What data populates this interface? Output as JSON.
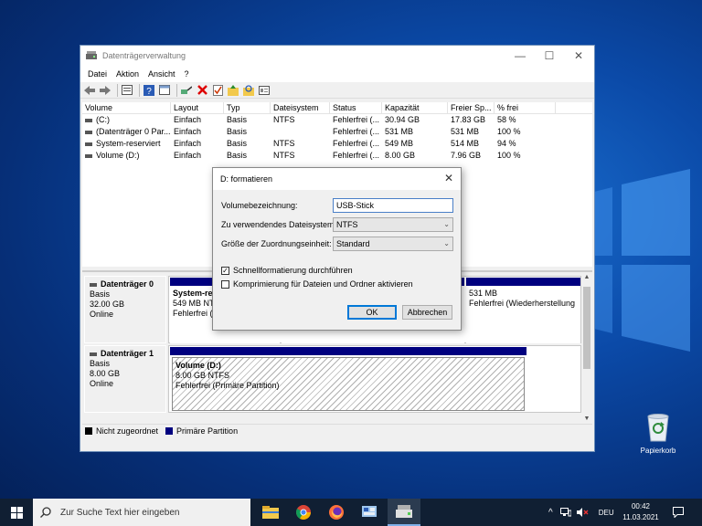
{
  "window": {
    "title": "Datenträgerverwaltung",
    "controls": {
      "minimize": "—",
      "maximize": "☐",
      "close": "✕"
    }
  },
  "menu": [
    "Datei",
    "Aktion",
    "Ansicht",
    "?"
  ],
  "toolbar": [
    "back-icon",
    "forward-icon",
    "properties-icon",
    "help-icon",
    "console-icon",
    "connect-icon",
    "delete-icon",
    "check-icon",
    "folder-up-icon",
    "folder-search-icon",
    "view-icon"
  ],
  "volume_list": {
    "headers": [
      "Volume",
      "Layout",
      "Typ",
      "Dateisystem",
      "Status",
      "Kapazität",
      "Freier Sp...",
      "% frei"
    ],
    "rows": [
      [
        "(C:)",
        "Einfach",
        "Basis",
        "NTFS",
        "Fehlerfrei (...",
        "30.94 GB",
        "17.83 GB",
        "58 %"
      ],
      [
        "(Datenträger 0 Par...",
        "Einfach",
        "Basis",
        "",
        "Fehlerfrei (...",
        "531 MB",
        "531 MB",
        "100 %"
      ],
      [
        "System-reserviert",
        "Einfach",
        "Basis",
        "NTFS",
        "Fehlerfrei (...",
        "549 MB",
        "514 MB",
        "94 %"
      ],
      [
        "Volume (D:)",
        "Einfach",
        "Basis",
        "NTFS",
        "Fehlerfrei (...",
        "8.00 GB",
        "7.96 GB",
        "100 %"
      ]
    ]
  },
  "disks": [
    {
      "name": "Datenträger 0",
      "type": "Basis",
      "size": "32.00 GB",
      "state": "Online",
      "partitions": [
        {
          "name": "System-res",
          "line2": "549 MB NTF",
          "line3": "Fehlerfrei (S"
        },
        {
          "name": "",
          "line2": "531 MB",
          "line3": "Fehlerfrei (Wiederherstellung"
        }
      ]
    },
    {
      "name": "Datenträger 1",
      "type": "Basis",
      "size": "8.00 GB",
      "state": "Online",
      "partitions": [
        {
          "name": "Volume  (D:)",
          "line2": "8.00 GB NTFS",
          "line3": "Fehlerfrei (Primäre Partition)"
        }
      ]
    }
  ],
  "legend": [
    {
      "label": "Nicht zugeordnet",
      "color": "#000000"
    },
    {
      "label": "Primäre Partition",
      "color": "#00007f"
    }
  ],
  "dialog": {
    "title": "D: formatieren",
    "close": "✕",
    "volume_label_label": "Volumebezeichnung:",
    "volume_label_value": "USB-Stick",
    "filesystem_label": "Zu verwendendes Dateisystem:",
    "filesystem_value": "NTFS",
    "allocation_label": "Größe der Zuordnungseinheit:",
    "allocation_value": "Standard",
    "quick_format_label": "Schnellformatierung durchführen",
    "quick_format_checked": "✓",
    "compression_label": "Komprimierung für Dateien und Ordner aktivieren",
    "ok": "OK",
    "cancel": "Abbrechen"
  },
  "desktop": {
    "recycle_bin": "Papierkorb"
  },
  "taskbar": {
    "search_placeholder": "Zur Suche Text hier eingeben",
    "language": "DEU",
    "time": "00:42",
    "date": "11.03.2021",
    "apps": [
      "file-explorer-icon",
      "chrome-icon",
      "firefox-icon",
      "control-panel-icon",
      "disk-management-icon"
    ]
  }
}
